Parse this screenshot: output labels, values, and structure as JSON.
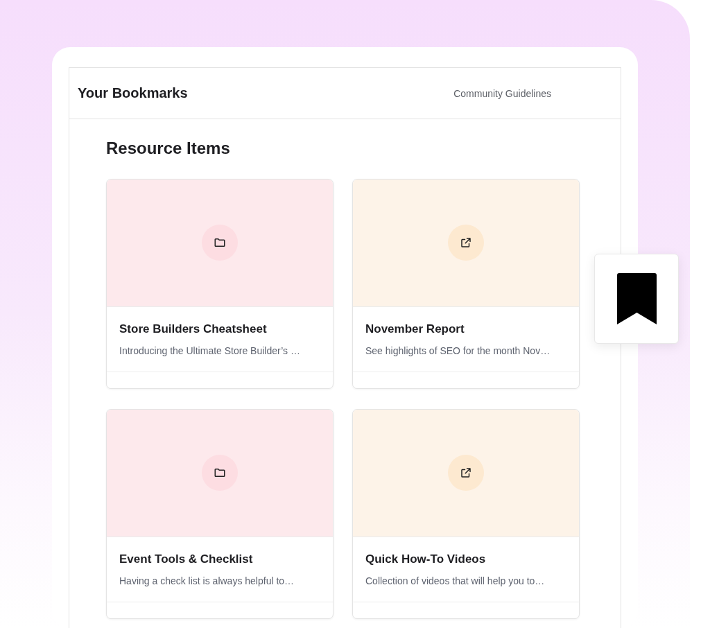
{
  "header": {
    "title": "Your Bookmarks",
    "link": "Community Guidelines"
  },
  "section": {
    "title": "Resource Items"
  },
  "cards": [
    {
      "kind": "folder",
      "title": "Store Builders Cheatsheet",
      "description": "Introducing the Ultimate Store Builder’s …"
    },
    {
      "kind": "link",
      "title": "November Report",
      "description": "See highlights of SEO for the month Nov…"
    },
    {
      "kind": "folder",
      "title": "Event Tools & Checklist",
      "description": "Having a check list is always helpful to…"
    },
    {
      "kind": "link",
      "title": "Quick How-To Videos",
      "description": "Collection of videos that will help you to…"
    }
  ]
}
